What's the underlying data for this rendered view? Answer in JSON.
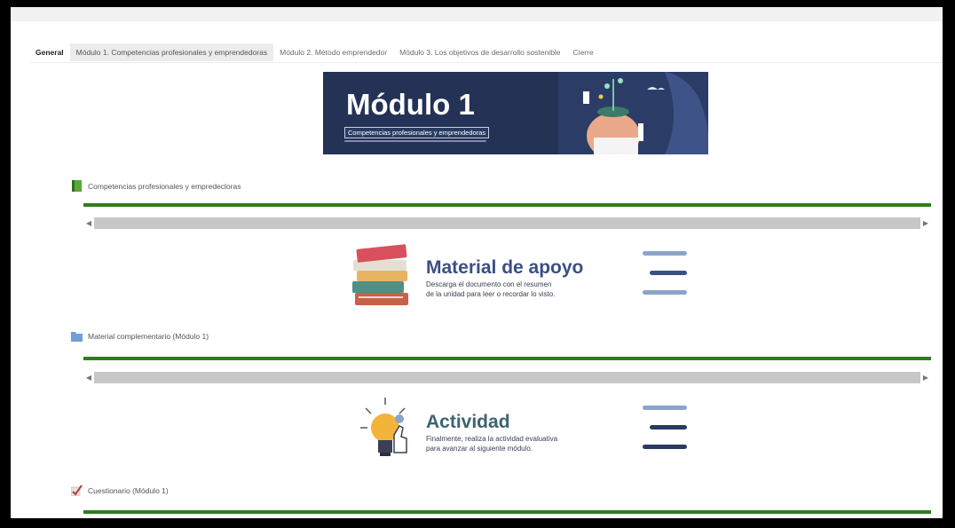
{
  "tabs": [
    {
      "label": "General"
    },
    {
      "label": "Módulo 1. Competencias profesionales y emprendedoras"
    },
    {
      "label": "Módulo 2. Método emprendedor"
    },
    {
      "label": "Módulo 3. Los objetivos de desarrollo sostenible"
    },
    {
      "label": "Cierre"
    }
  ],
  "banner": {
    "title": "Módulo 1",
    "subtitle": "Competencias profesionales y emprendedoras"
  },
  "sections": [
    {
      "label": "Competencias profesionales y empredecloras",
      "icon": "book-icon"
    },
    {
      "label": "Material complementario (Módulo 1)",
      "icon": "folder-icon"
    },
    {
      "label": "Cuestionario (Módulo 1)",
      "icon": "quiz-check-icon"
    }
  ],
  "cards": {
    "material": {
      "title": "Material de apoyo",
      "desc1": "Descarga el documento con el resumen",
      "desc2": "de la unidad para leer o recordar lo visto."
    },
    "activity": {
      "title": "Actividad",
      "desc1": "Finalmente, realiza la actividad evaluativa",
      "desc2": "para avanzar al siguiente módulo."
    }
  },
  "colors": {
    "accent_green": "#2e7d1f",
    "banner_bg": "#233255",
    "card_title": "#3a4f86"
  }
}
